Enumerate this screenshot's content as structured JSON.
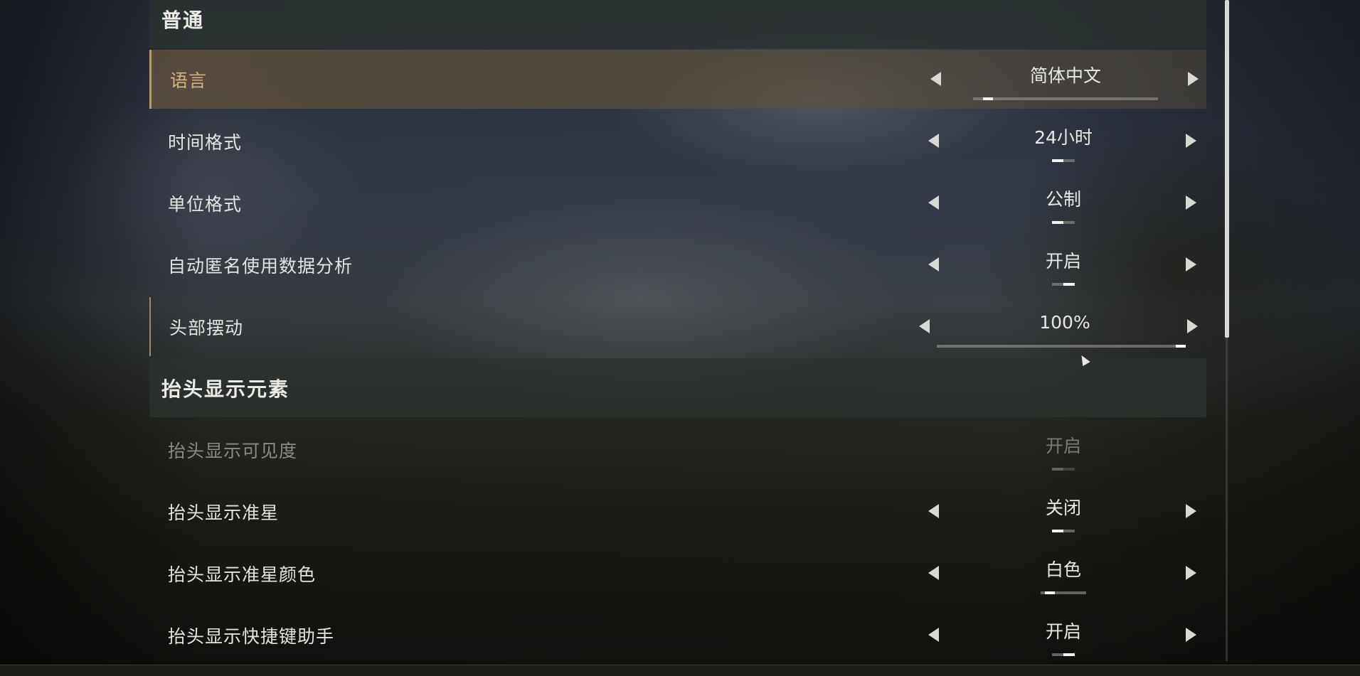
{
  "sections": [
    {
      "title": "普通",
      "rows": [
        {
          "label": "语言",
          "value": "简体中文",
          "fill": 0.08,
          "selected": true
        },
        {
          "label": "时间格式",
          "value": "24小时",
          "fill": 0.5
        },
        {
          "label": "单位格式",
          "value": "公制",
          "fill": 0.5
        },
        {
          "label": "自动匿名使用数据分析",
          "value": "开启",
          "fill": 0.5
        },
        {
          "label": "头部摆动",
          "value": "100%",
          "fill": 1.0
        }
      ]
    },
    {
      "title": "抬头显示元素",
      "rows": [
        {
          "label": "抬头显示可见度",
          "value": "开启",
          "fill": 0.5,
          "disabled": true
        },
        {
          "label": "抬头显示准星",
          "value": "关闭",
          "fill": 0.5
        },
        {
          "label": "抬头显示准星颜色",
          "value": "白色",
          "fill": 0.2
        },
        {
          "label": "抬头显示快捷键助手",
          "value": "开启",
          "fill": 0.5
        }
      ]
    }
  ],
  "icons": {
    "left": "arrow-left-icon",
    "right": "arrow-right-icon",
    "cursor": "mouse-cursor-icon"
  },
  "colors": {
    "selected_label": "#d6b27c",
    "selected_accent": "#b69a73",
    "text": "#e4e4e0",
    "disabled_text": "#8a8a86"
  }
}
